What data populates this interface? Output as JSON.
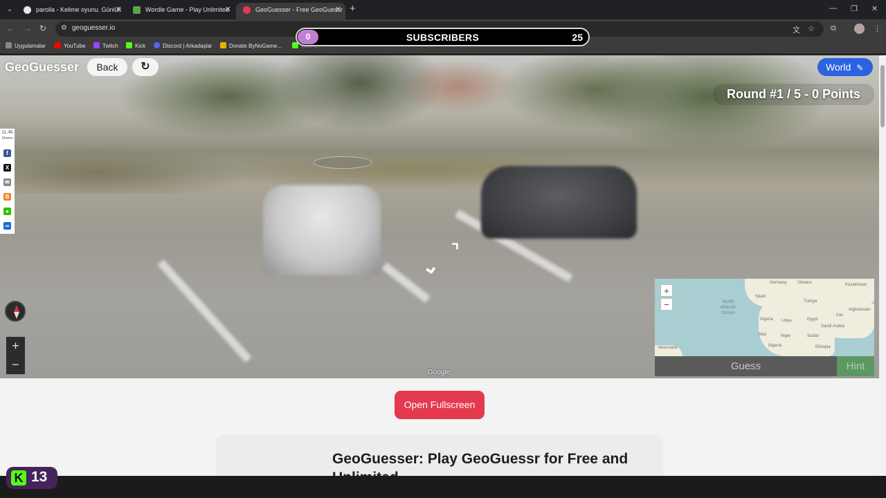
{
  "browser": {
    "tabs": [
      {
        "title": "parolla - Kelime oyunu. Günlük"
      },
      {
        "title": "Wordle Game - Play Unlimited"
      },
      {
        "title": "GeoGuesser - Free GeoGuessr"
      }
    ],
    "url": "geoguesser.io",
    "bookmarks": [
      "Uygulamalar",
      "YouTube",
      "Twitch",
      "Kick",
      "Discord | Arkadaşlar",
      "Donate ByNoGame...",
      "Kick C..."
    ]
  },
  "subscriber_goal": {
    "current": "0",
    "label": "SUBSCRIBERS",
    "goal": "25",
    "progress_fraction": 0
  },
  "game": {
    "brand": "GeoGuesser",
    "back_label": "Back",
    "refresh_icon": "↻",
    "mode_label": "World",
    "round_text": "Round #1 / 5 - 0 Points",
    "google_label": "Google",
    "guess_label": "Guess",
    "hint_label": "Hint",
    "share_count": "11.4k",
    "share_caption": "Shares",
    "zoom_in": "+",
    "zoom_out": "−"
  },
  "minimap": {
    "labels": [
      "Germany",
      "Ukraine",
      "Kazakhstan",
      "Spain",
      "Türkiye",
      "North Atlantic Ocean",
      "Afghanistan",
      "Algeria",
      "Libya",
      "Egypt",
      "Iran",
      "Saudi Arabia",
      "Mali",
      "Niger",
      "Sudan",
      "Nigeria",
      "Ethiopia",
      "Venezuela"
    ]
  },
  "page": {
    "fullscreen_label": "Open Fullscreen",
    "article_title": "GeoGuesser: Play GeoGuessr for Free and Unlimited"
  },
  "kick_overlay": {
    "viewers": "13"
  },
  "colors": {
    "accent_blue": "#2b62e0",
    "fullscreen_red": "#e5394e",
    "hint_green": "#5d9862",
    "kick_green": "#53fc18",
    "sub_bar_purple": "#c07fd6"
  }
}
